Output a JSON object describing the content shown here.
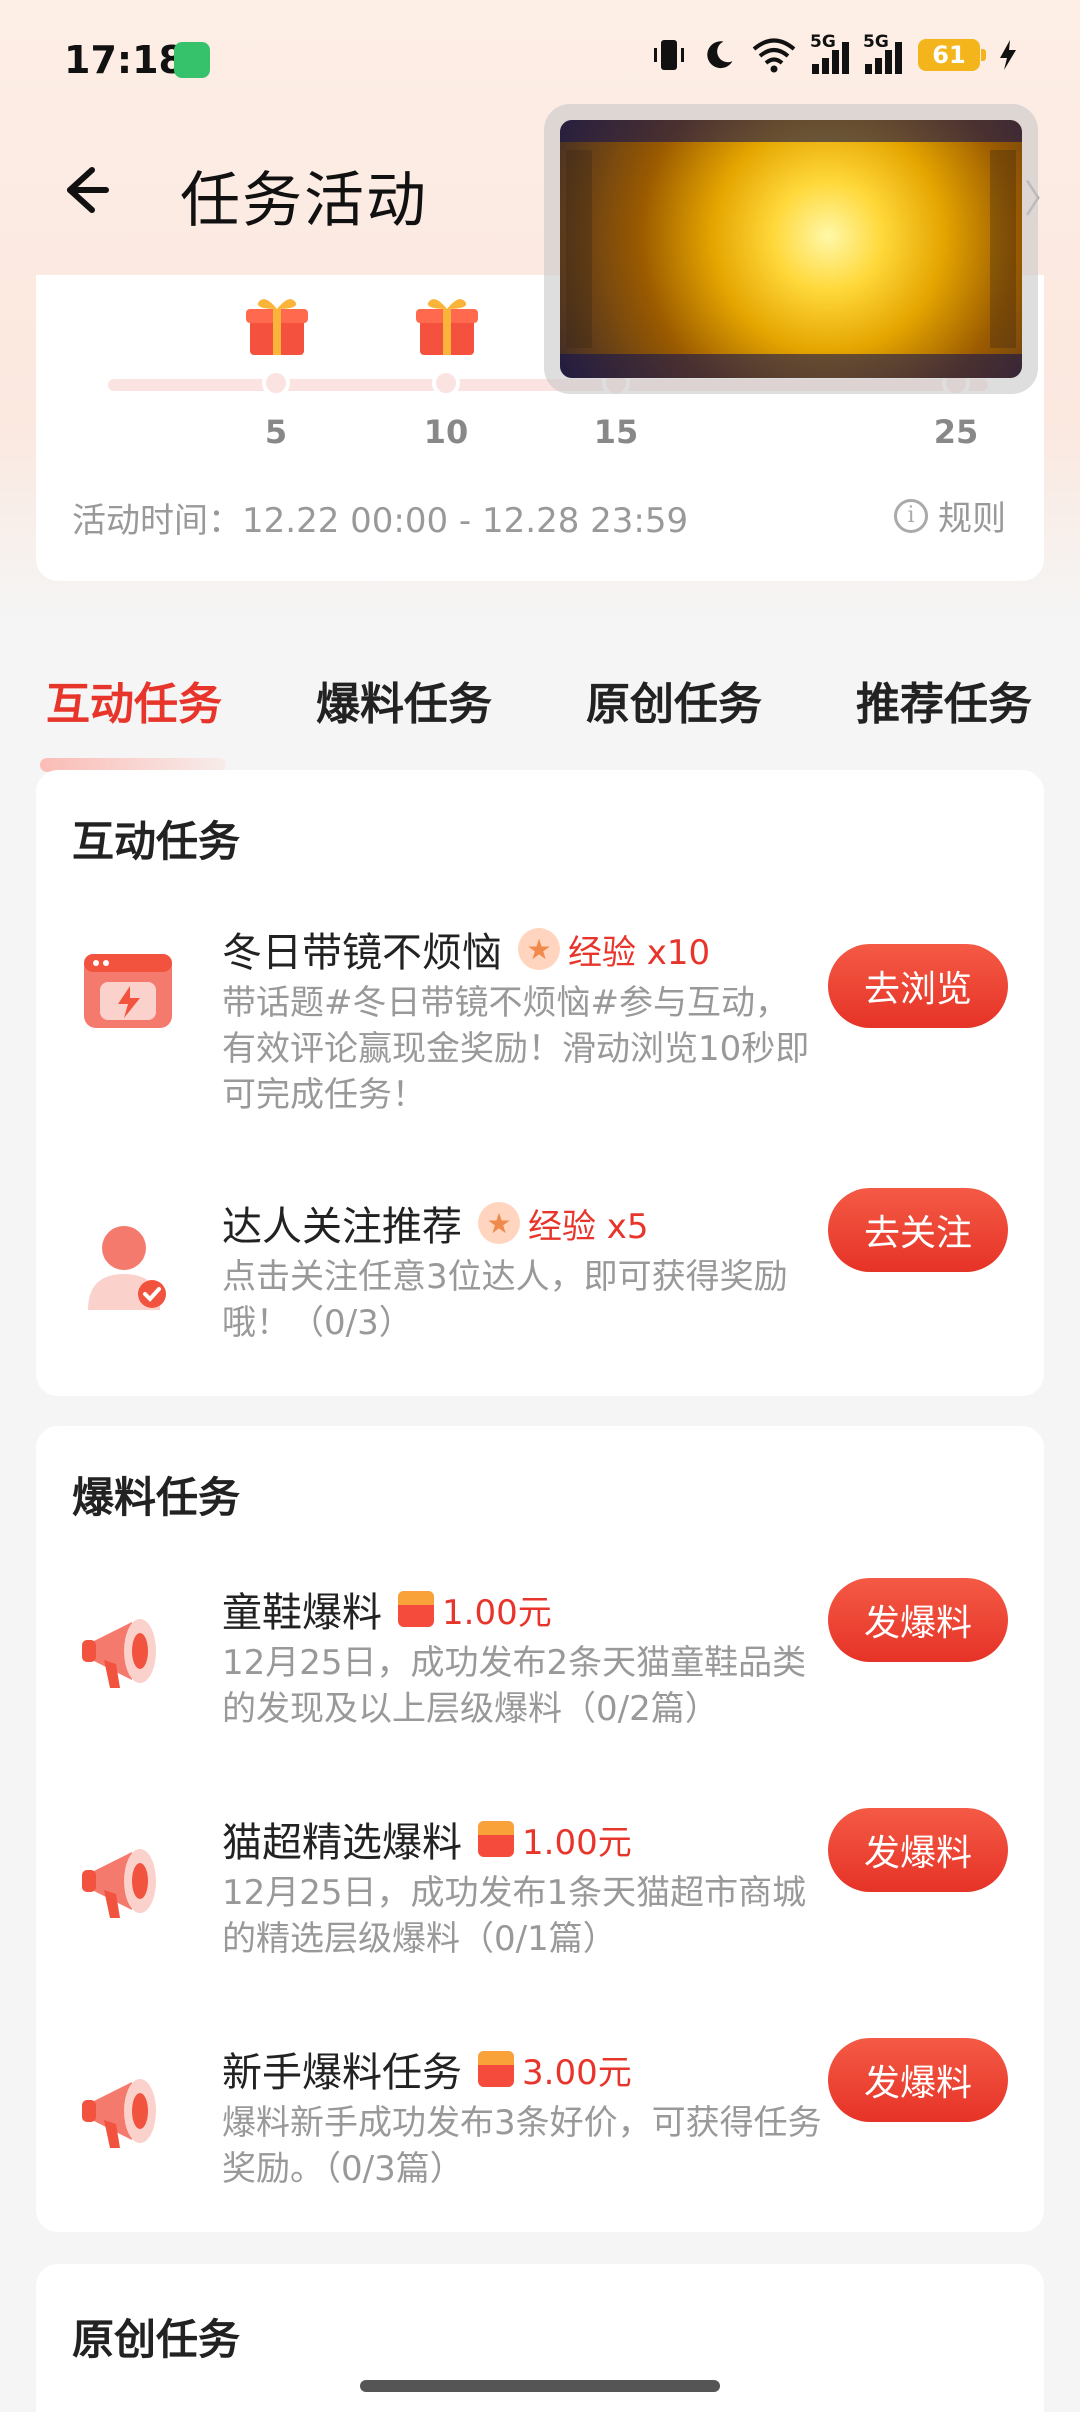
{
  "status_bar": {
    "time": "17:18",
    "battery": "61",
    "network_1": "5G",
    "network_2": "5G"
  },
  "header": {
    "title": "任务活动",
    "right_text": "动〉"
  },
  "progress": {
    "milestones": [
      "5",
      "10",
      "15",
      "25"
    ],
    "activity_time": "活动时间：12.22 00:00 - 12.28 23:59",
    "rule_label": "规则"
  },
  "tabs": [
    "互动任务",
    "爆料任务",
    "原创任务",
    "推荐任务"
  ],
  "sections": {
    "interact": {
      "title": "互动任务",
      "tasks": [
        {
          "name": "冬日带镜不烦恼",
          "reward": "经验 x10",
          "desc": "带话题#冬日带镜不烦恼#参与互动，有效评论赢现金奖励！滑动浏览10秒即可完成任务！",
          "button": "去浏览"
        },
        {
          "name": "达人关注推荐",
          "reward": "经验 x5",
          "desc": "点击关注任意3位达人，即可获得奖励哦！（0/3）",
          "button": "去关注"
        }
      ]
    },
    "tipoff": {
      "title": "爆料任务",
      "tasks": [
        {
          "name": "童鞋爆料",
          "reward": "1.00元",
          "desc": "12月25日，成功发布2条天猫童鞋品类的发现及以上层级爆料（0/2篇）",
          "button": "发爆料"
        },
        {
          "name": "猫超精选爆料",
          "reward": "1.00元",
          "desc": "12月25日，成功发布1条天猫超市商城的精选层级爆料（0/1篇）",
          "button": "发爆料"
        },
        {
          "name": "新手爆料任务",
          "reward": "3.00元",
          "desc": "爆料新手成功发布3条好价，可获得任务奖励。（0/3篇）",
          "button": "发爆料"
        }
      ]
    },
    "original": {
      "title": "原创任务"
    }
  },
  "colors": {
    "accent": "#e8352b",
    "button_gradient_top": "#f45a45",
    "button_gradient_bottom": "#e63327"
  }
}
